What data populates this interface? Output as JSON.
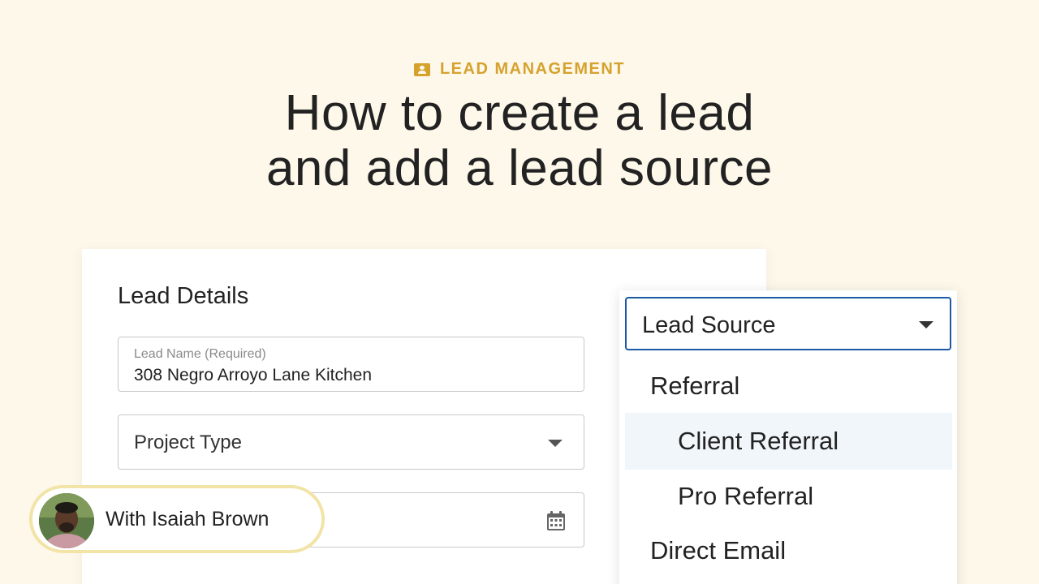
{
  "header": {
    "eyebrow_icon": "contact-card-icon",
    "eyebrow": "LEAD MANAGEMENT",
    "title_line1": "How to create a lead",
    "title_line2": "and add a lead source"
  },
  "form": {
    "title": "Lead Details",
    "lead_name": {
      "label": "Lead Name (Required)",
      "value": "308 Negro Arroyo Lane Kitchen"
    },
    "project_type": {
      "placeholder": "Project Type"
    },
    "date_field": {
      "icon": "calendar-icon"
    }
  },
  "lead_source": {
    "selected_label": "Lead Source",
    "options": [
      {
        "label": "Referral",
        "level": 1,
        "highlighted": false
      },
      {
        "label": "Client Referral",
        "level": 2,
        "highlighted": true
      },
      {
        "label": "Pro Referral",
        "level": 2,
        "highlighted": false
      },
      {
        "label": "Direct Email",
        "level": 1,
        "highlighted": false
      }
    ]
  },
  "presenter": {
    "label": "With Isaiah Brown"
  },
  "colors": {
    "background": "#fdf8ea",
    "accent": "#d6a22e",
    "select_border": "#1d5aa5",
    "highlight_row": "#f1f6fb",
    "presenter_border": "#f2e3a6"
  }
}
